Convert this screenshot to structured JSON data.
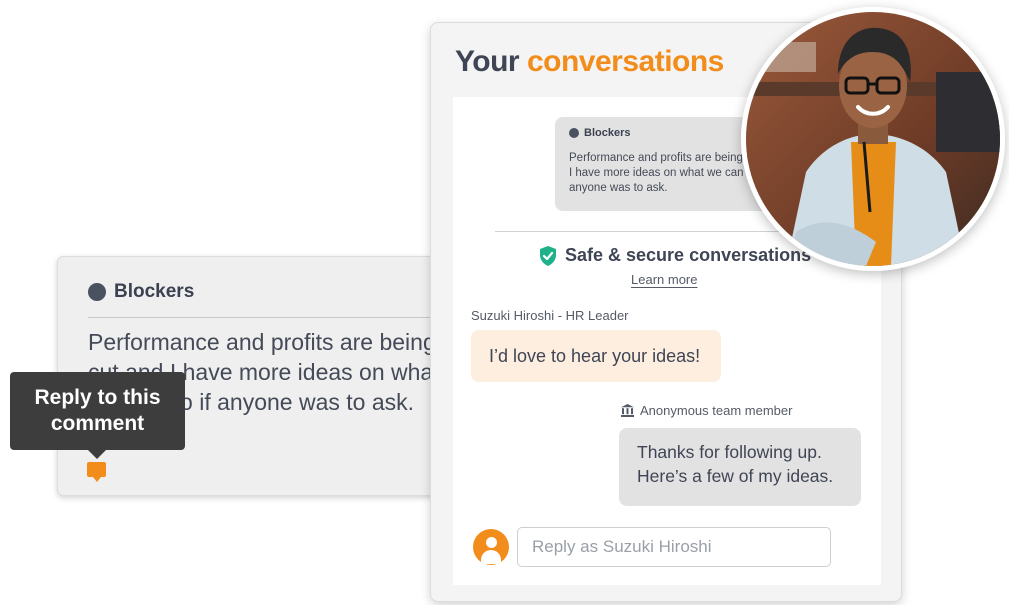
{
  "left_card": {
    "topic": "Blockers",
    "comment": "Performance and profits are being cut and I have more ideas on what we can do if anyone was to ask."
  },
  "tooltip": {
    "line1": "Reply to this",
    "line2": "comment"
  },
  "panel": {
    "title_main": "Your",
    "title_accent": "conversations",
    "quote": {
      "topic": "Blockers",
      "text": "Performance and profits are being cut and I have more ideas on what we can do if anyone was to ask."
    },
    "secure_label": "Safe & secure conversations",
    "learn_more": "Learn more",
    "sender": "Suzuki Hiroshi - HR Leader",
    "incoming_message": "I’d love to hear your ideas!",
    "anonymous_label": "Anonymous team member",
    "outgoing_message_line1": "Thanks for following up.",
    "outgoing_message_line2": "Here’s a few of my ideas.",
    "reply_placeholder": "Reply as Suzuki Hiroshi",
    "reply_value": ""
  },
  "colors": {
    "accent": "#f28c1b",
    "title_text": "#3f4554",
    "shield": "#1fb28a",
    "bubble_incoming": "#fdeee0",
    "bubble_outgoing": "#e2e2e2",
    "tooltip_bg": "#3d3d3d"
  },
  "icons": {
    "topic": "topic-dot-icon",
    "secure": "shield-check-icon",
    "anonymous": "building-icon",
    "reply": "chat-bubble-icon",
    "avatar": "user-avatar-icon"
  }
}
